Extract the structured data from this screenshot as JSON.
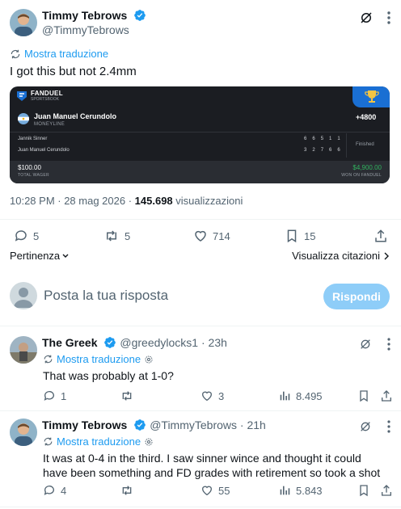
{
  "tweet": {
    "author_name": "Timmy Tebrows",
    "author_handle": "@TimmyTebrows",
    "translate_label": "Mostra traduzione",
    "text": "I got this but not 2.4mm",
    "time": "10:28 PM · 28 mag 2026 · ",
    "views_count": "145.698",
    "views_label": " visualizzazioni",
    "replies": "5",
    "retweets": "5",
    "likes": "714",
    "bookmarks": "15"
  },
  "bet_card": {
    "brand_line1": "FANDUEL",
    "brand_line2": "SPORTSBOOK",
    "player": "Juan Manuel Cerundolo",
    "market": "MONEYLINE",
    "odds": "+4800",
    "row1_name": "Jannik Sinner",
    "row1_scores": [
      "6",
      "6",
      "5",
      "1",
      "1"
    ],
    "row2_name": "Juan Manuel Cerundolo",
    "row2_scores": [
      "3",
      "2",
      "7",
      "6",
      "6"
    ],
    "status": "Finished",
    "wager_amount": "$100.00",
    "wager_label": "TOTAL WAGER",
    "won_amount": "$4,900.00",
    "won_label": "WON ON FANDUEL",
    "colors": {
      "card_bg": "#1b1d22",
      "footer_bg": "#2a2d33",
      "won_green": "#31b15f",
      "trophy_bg": "#1a6fd3"
    }
  },
  "sort": {
    "label": "Pertinenza",
    "quotes_label": "Visualizza citazioni"
  },
  "composer": {
    "placeholder": "Posta la tua risposta",
    "button_label": "Rispondi"
  },
  "replies": [
    {
      "author_name": "The Greek",
      "author_handle": "@greedylocks1",
      "time": " · 23h",
      "translate_label": "Mostra traduzione",
      "text": "That was probably at 1-0?",
      "replies": "1",
      "retweets": "",
      "likes": "3",
      "views": "8.495"
    },
    {
      "author_name": "Timmy Tebrows",
      "author_handle": "@TimmyTebrows",
      "time": " · 21h",
      "translate_label": "Mostra traduzione",
      "text": "It was at 0-4 in the third. I saw sinner wince and thought it could have been something and FD grades with retirement so took a shot",
      "replies": "4",
      "retweets": "",
      "likes": "55",
      "views": "5.843"
    }
  ],
  "colors": {
    "accent": "#1d9bf0",
    "muted": "#536471",
    "separator": "#eff3f4"
  }
}
